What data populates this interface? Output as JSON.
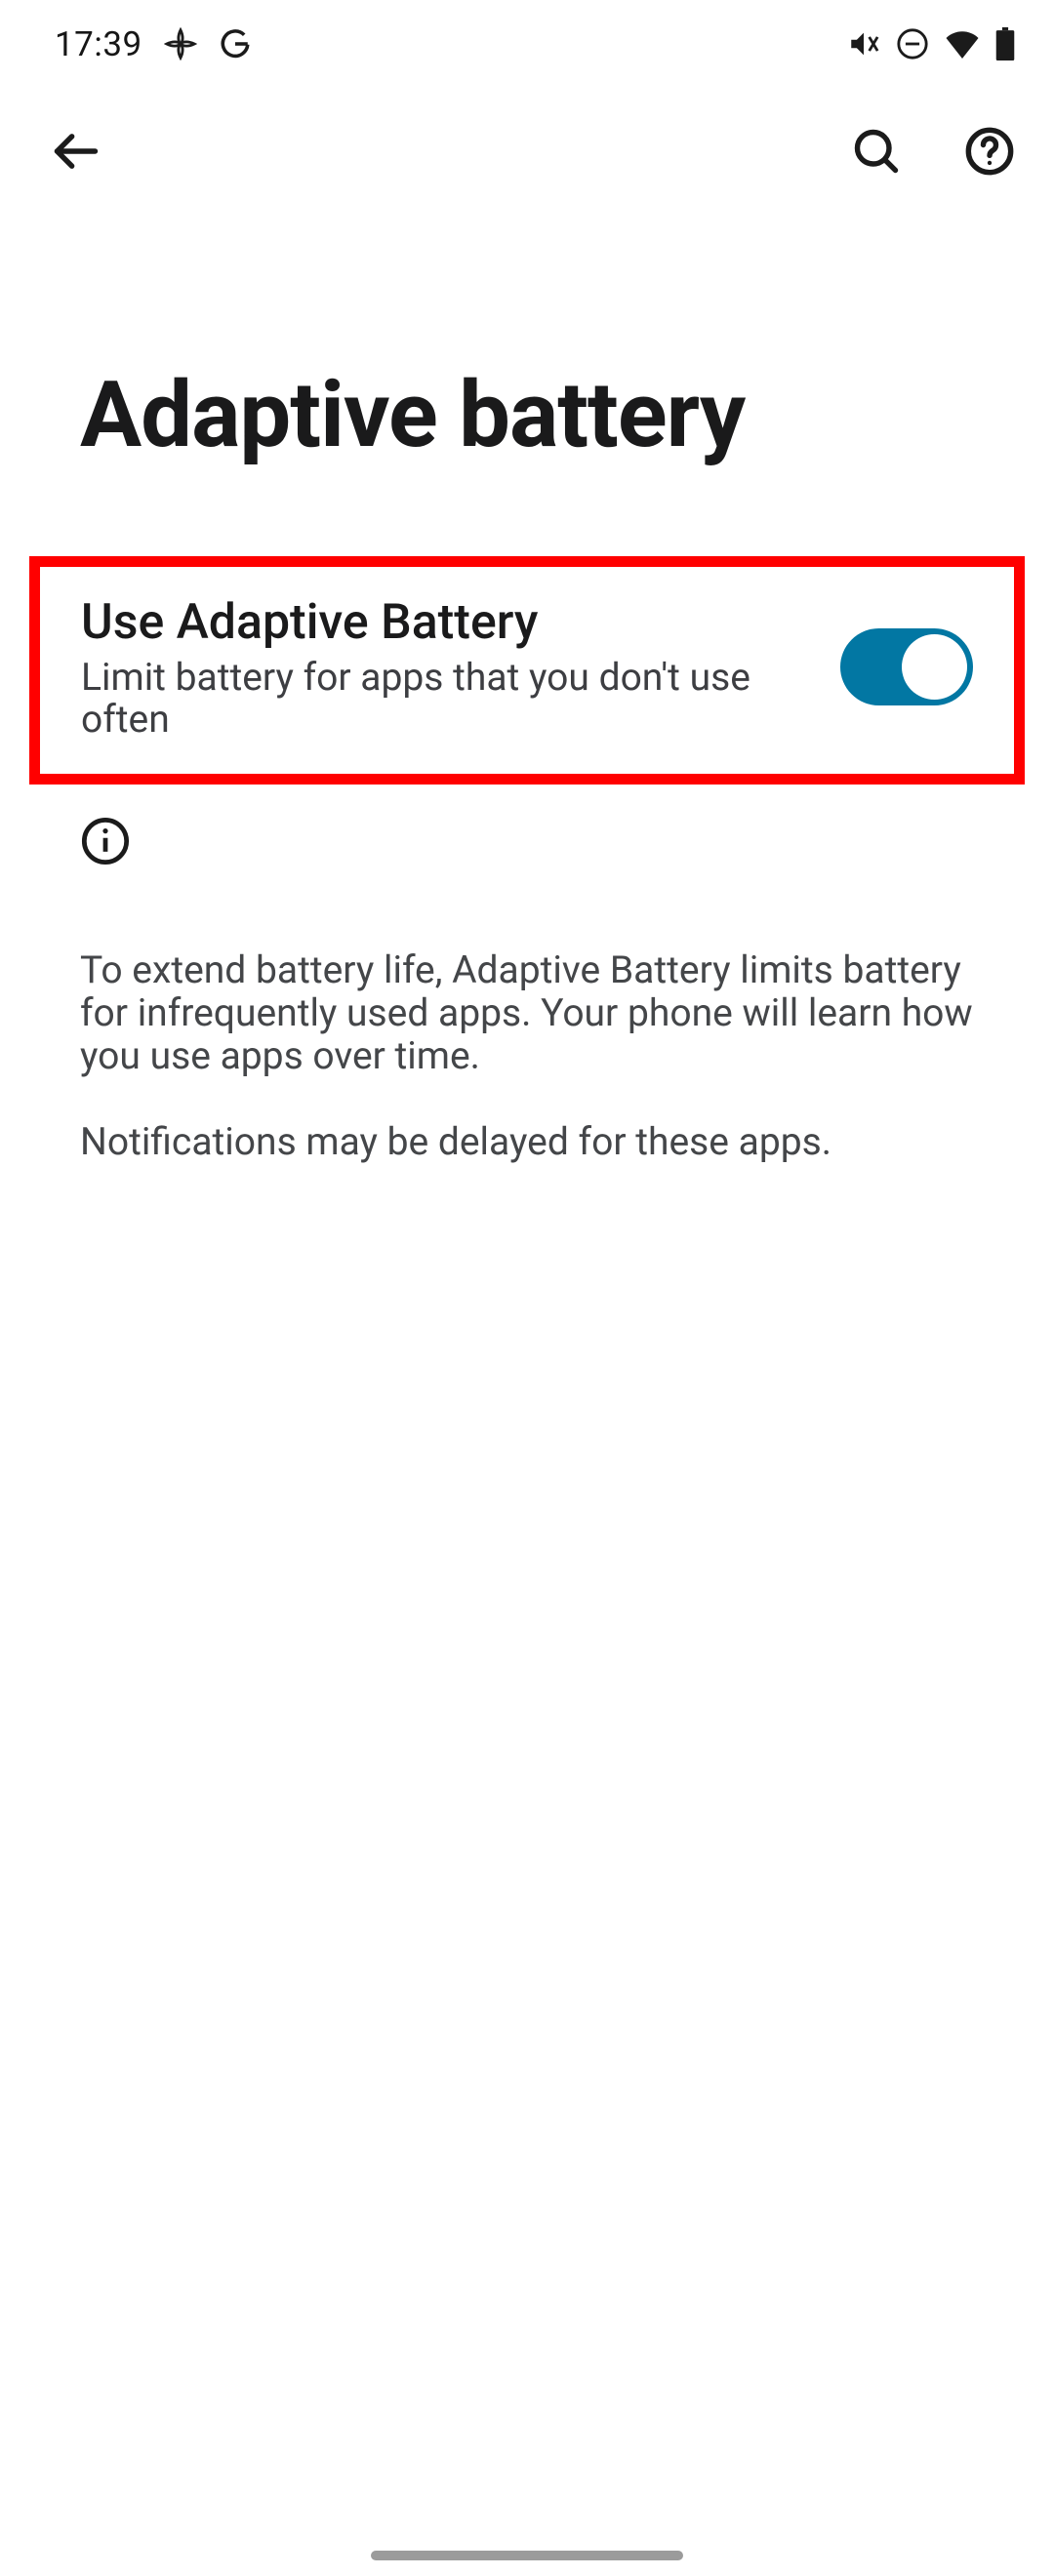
{
  "status": {
    "time": "17:39"
  },
  "page": {
    "title": "Adaptive battery"
  },
  "setting": {
    "title": "Use Adaptive Battery",
    "subtitle": "Limit battery for apps that you don't use often",
    "enabled": true
  },
  "description": {
    "p1": "To extend battery life, Adaptive Battery limits battery for infrequently used apps. Your phone will learn how you use apps over time.",
    "p2": "Notifications may be delayed for these apps."
  },
  "colors": {
    "switch_on": "#0277a3",
    "highlight": "#ff0000"
  }
}
